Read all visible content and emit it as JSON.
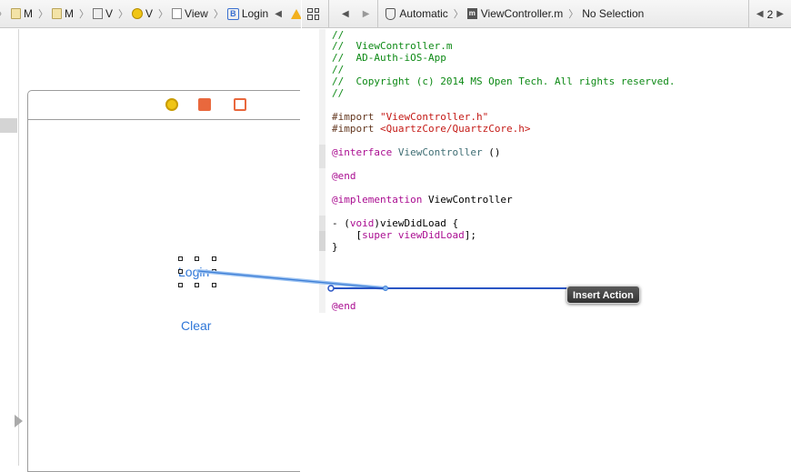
{
  "left_jumpbar": {
    "crumbs": [
      {
        "icon": "folder-icon",
        "label": "M"
      },
      {
        "icon": "folder-icon",
        "label": "M"
      },
      {
        "icon": "storyboard-icon",
        "label": "V"
      },
      {
        "icon": "view-controller-icon",
        "label": "V"
      },
      {
        "icon": "view-icon",
        "label": "View"
      },
      {
        "icon": "button-icon",
        "label": "Login",
        "icon_text": "B"
      }
    ]
  },
  "right_jumpbar": {
    "mode_label": "Automatic",
    "file_icon_text": "m",
    "file_label": "ViewController.m",
    "selection_label": "No Selection",
    "counter": "2"
  },
  "canvas": {
    "login_label": "Login",
    "clear_label": "Clear"
  },
  "code": {
    "lines": [
      {
        "text": "//",
        "kind": "comment"
      },
      {
        "text": "//  ViewController.m",
        "kind": "comment"
      },
      {
        "text": "//  AD-Auth-iOS-App",
        "kind": "comment"
      },
      {
        "text": "//",
        "kind": "comment"
      },
      {
        "text": "//  Copyright (c) 2014 MS Open Tech. All rights reserved.",
        "kind": "comment"
      },
      {
        "text": "//",
        "kind": "comment"
      },
      {
        "text": "#import \"ViewController.h\"",
        "kind": "import-string"
      },
      {
        "text": "#import <QuartzCore/QuartzCore.h>",
        "kind": "import-string"
      },
      {
        "text": "@interface ViewController ()",
        "kind": "interface"
      },
      {
        "text": "@end",
        "kind": "keyword"
      },
      {
        "text": "@implementation ViewController",
        "kind": "implementation"
      },
      {
        "text": "- (void)viewDidLoad {",
        "kind": "method"
      },
      {
        "text": "    [super viewDidLoad];",
        "kind": "super-call"
      },
      {
        "text": "}",
        "kind": "plain"
      },
      {
        "text": "@end",
        "kind": "keyword"
      }
    ]
  },
  "connection": {
    "tooltip": "Insert Action"
  },
  "colors": {
    "comment": "#0e8a16",
    "string": "#c41a16",
    "keyword": "#aa0d91",
    "class": "#3f6e74",
    "button_text": "#2f77d8",
    "connection_line": "#2a55c4"
  }
}
